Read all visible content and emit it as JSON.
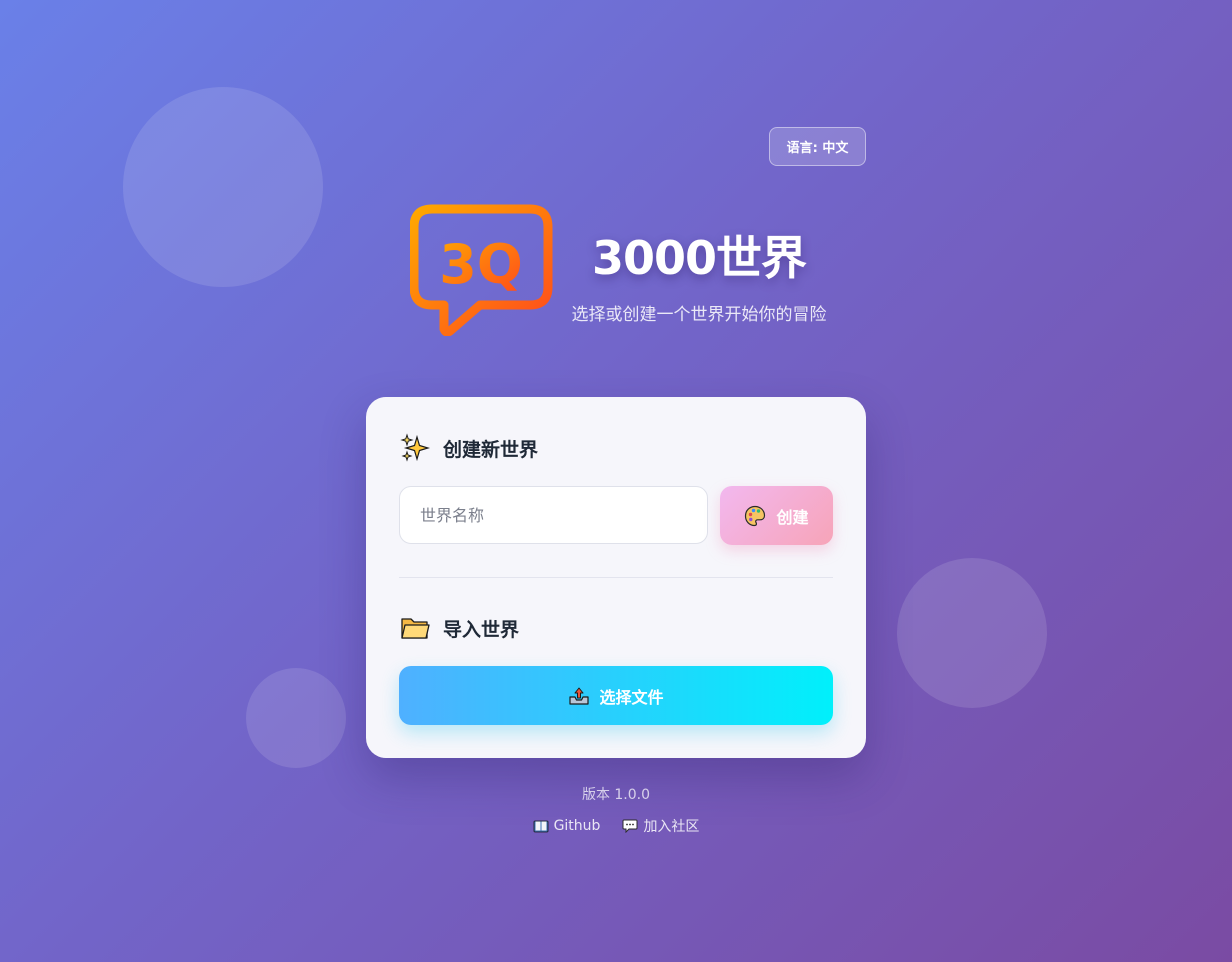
{
  "language_button": {
    "label": "语言: 中文"
  },
  "app": {
    "logo_text": "3Q",
    "title": "3000世界",
    "subtitle": "选择或创建一个世界开始你的冒险"
  },
  "create_section": {
    "icon": "sparkles-icon",
    "heading": "创建新世界",
    "name_input": {
      "placeholder": "世界名称",
      "value": ""
    },
    "create_button": {
      "icon": "palette-icon",
      "label": "创建"
    }
  },
  "import_section": {
    "icon": "folder-icon",
    "heading": "导入世界",
    "choose_file_button": {
      "icon": "upload-tray-icon",
      "label": "选择文件"
    }
  },
  "footer": {
    "version": "版本 1.0.0",
    "links": [
      {
        "icon": "book-icon",
        "label": "Github"
      },
      {
        "icon": "speech-bubble-icon",
        "label": "加入社区"
      }
    ]
  },
  "colors": {
    "background_start": "#6a80e8",
    "background_end": "#7a4ba3",
    "create_button": "#f7a4b8",
    "file_button_start": "#4fb0ff",
    "file_button_end": "#00f0fb",
    "logo_orange": "#ff8a00"
  }
}
